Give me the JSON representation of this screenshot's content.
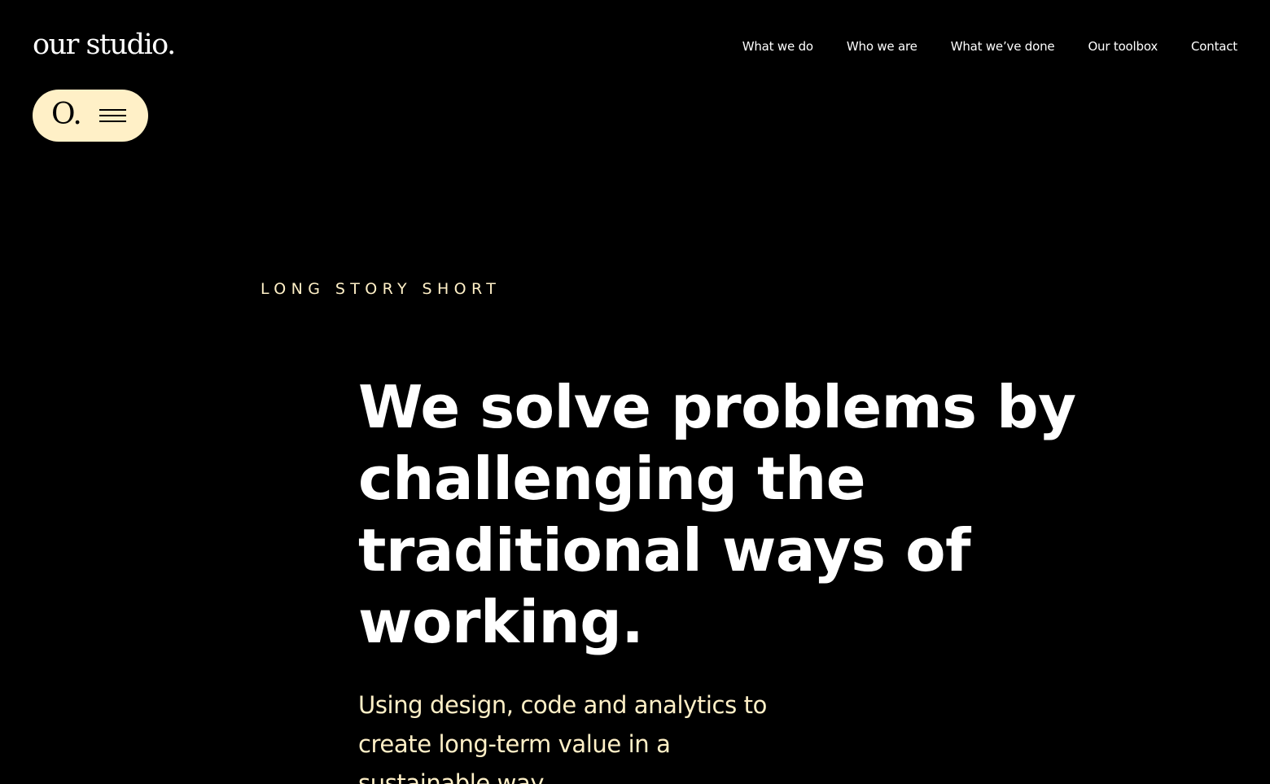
{
  "colors": {
    "background": "#000000",
    "text": "#ffffff",
    "accent": "#fff0c7"
  },
  "header": {
    "logo": "our studio.",
    "nav": [
      {
        "label": "What we do"
      },
      {
        "label": "Who we are"
      },
      {
        "label": "What we’ve done"
      },
      {
        "label": "Our toolbox"
      },
      {
        "label": "Contact"
      }
    ]
  },
  "menu_button": {
    "mark": "O.",
    "icon": "hamburger-icon"
  },
  "hero": {
    "eyebrow": "LONG STORY SHORT",
    "headline_lines": [
      "We solve problems by",
      "challenging the",
      "traditional ways of",
      "working."
    ],
    "subline_lines": [
      "Using design, code and analytics to",
      "create long-term value in a",
      "sustainable way."
    ]
  }
}
